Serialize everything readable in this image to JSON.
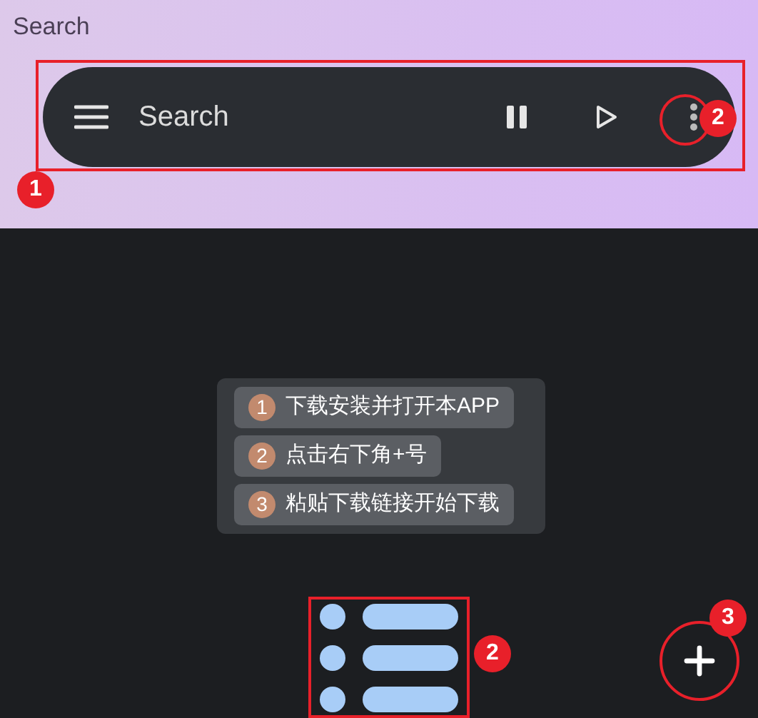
{
  "header": {
    "title": "Search"
  },
  "search_bar": {
    "placeholder": "Search"
  },
  "tips": [
    {
      "number": "1",
      "text": "下载安装并打开本APP"
    },
    {
      "number": "2",
      "text": "点击右下角+号"
    },
    {
      "number": "3",
      "text": "粘贴下载链接开始下载"
    }
  ],
  "annotations": {
    "search_bar": "1",
    "more_button": "2",
    "list_icon": "2",
    "add_button": "3"
  }
}
